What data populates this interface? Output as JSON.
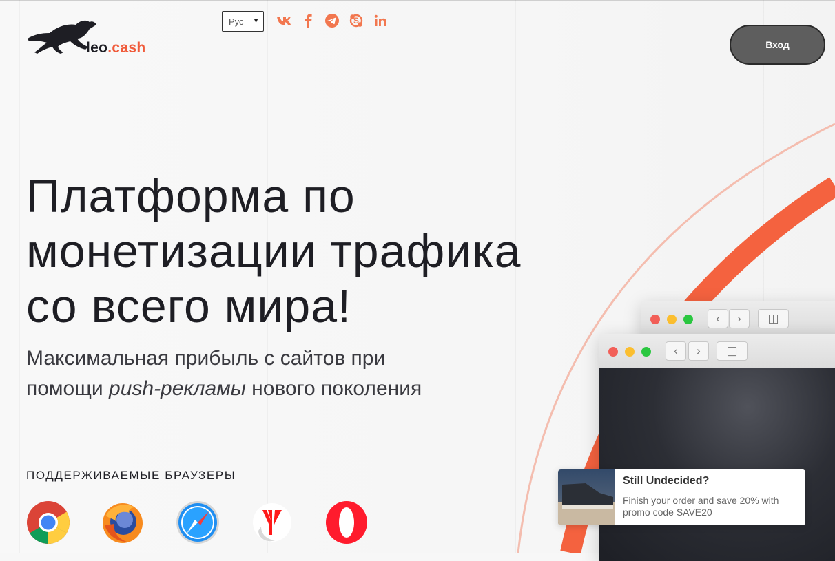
{
  "brand": {
    "name_a": "leo",
    "name_b": ".cash",
    "accent_color": "#f05b3b"
  },
  "header": {
    "language_selected": "Рус",
    "social_icons": [
      "vk-icon",
      "facebook-icon",
      "telegram-icon",
      "skype-icon",
      "linkedin-icon"
    ],
    "login_label": "Вход"
  },
  "hero": {
    "title_line1": "Платформа по",
    "title_line2": "монетизации трафика",
    "title_line3": "со всего мира!",
    "subtitle_line1": "Максимальная прибыль с сайтов при",
    "subtitle_prefix": "помощи ",
    "subtitle_italic": "push-рекламы",
    "subtitle_suffix": " нового поколения"
  },
  "browsers": {
    "label": "ПОДДЕРЖИВАЕМЫЕ БРАУЗЕРЫ",
    "icons": [
      "chrome-icon",
      "firefox-icon",
      "safari-icon",
      "yandex-browser-icon",
      "opera-icon"
    ]
  },
  "notification": {
    "title": "Still Undecided?",
    "text": "Finish your order and save 20% with promo code SAVE20"
  }
}
